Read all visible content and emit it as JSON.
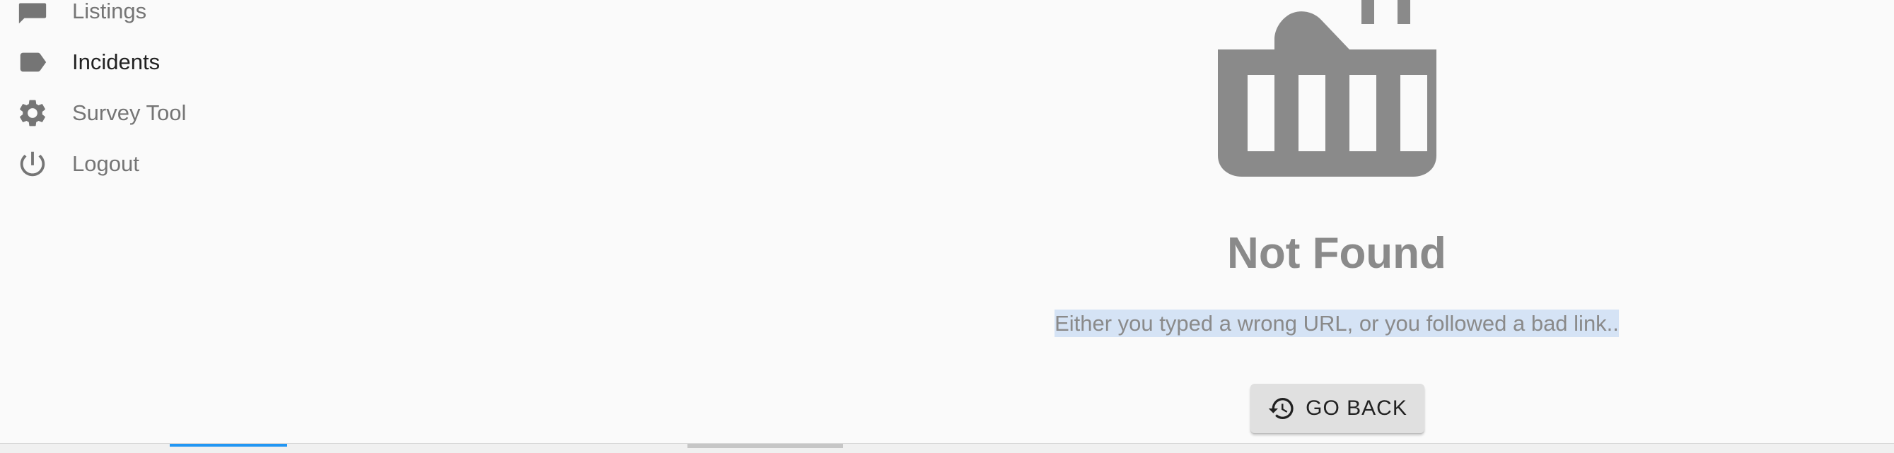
{
  "sidebar": {
    "items": [
      {
        "label": "Listings",
        "icon": "chat-bubble-icon",
        "active": false
      },
      {
        "label": "Incidents",
        "icon": "label-tag-icon",
        "active": true
      },
      {
        "label": "Survey Tool",
        "icon": "gear-icon",
        "active": false
      },
      {
        "label": "Logout",
        "icon": "power-icon",
        "active": false
      }
    ]
  },
  "main": {
    "icon": "broken-basket-icon",
    "title": "Not Found",
    "subtitle": "Either you typed a wrong URL, or you followed a bad link..",
    "button_label": "GO BACK",
    "button_icon": "history-icon"
  },
  "colors": {
    "icon_gray": "#8a8a8a",
    "accent_blue": "#2196f3",
    "selection": "#d5e3f5",
    "button_bg": "#e0e0e0"
  }
}
